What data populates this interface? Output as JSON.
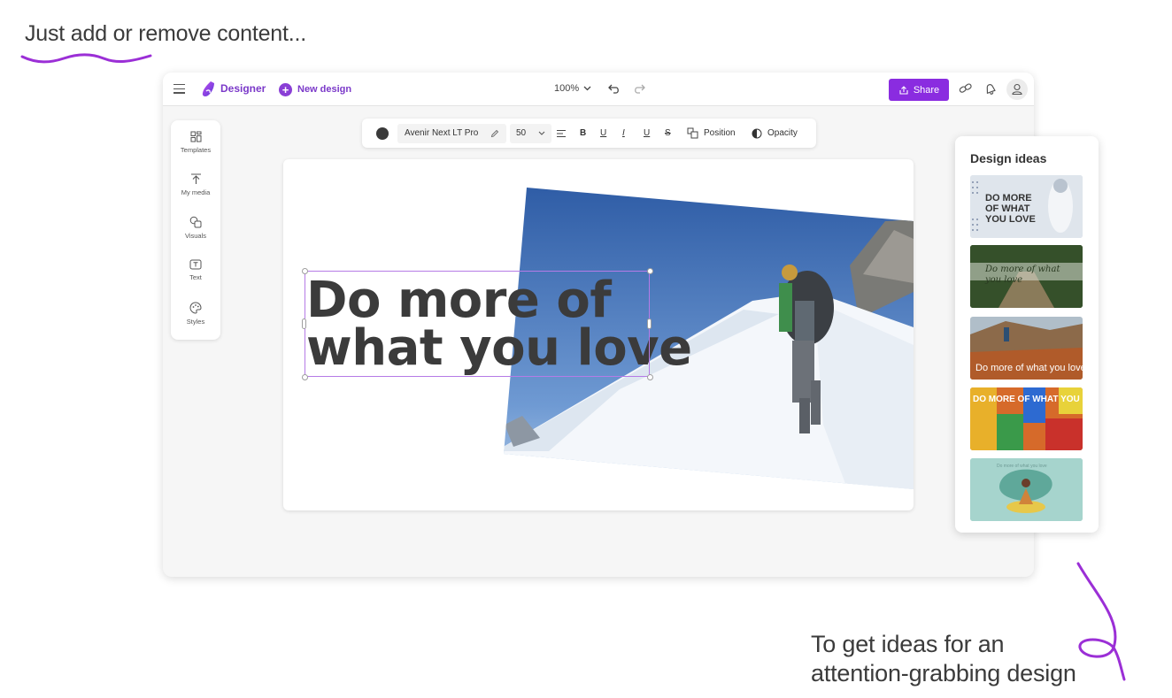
{
  "annotations": {
    "headline": "Just add or remove content...",
    "callout_line1": "To get ideas for an",
    "callout_line2": "attention-grabbing design",
    "ink_color": "#9b2fd6"
  },
  "topbar": {
    "brand": "Designer",
    "new_design": "New design",
    "zoom": "100%",
    "share": "Share",
    "accent": "#8a2ce0",
    "icons": [
      "menu-icon",
      "designer-logo-icon",
      "plus-circle-icon",
      "chevron-down-icon",
      "undo-icon",
      "redo-icon",
      "share-icon",
      "link-icon",
      "bell-icon",
      "person-icon"
    ]
  },
  "left_rail": {
    "items": [
      {
        "label": "Templates",
        "icon": "templates-icon"
      },
      {
        "label": "My media",
        "icon": "upload-icon"
      },
      {
        "label": "Visuals",
        "icon": "shapes-icon"
      },
      {
        "label": "Text",
        "icon": "text-box-icon"
      },
      {
        "label": "Styles",
        "icon": "palette-icon"
      }
    ]
  },
  "format_bar": {
    "font": "Avenir Next LT Pro",
    "size": "50",
    "bold": "B",
    "underline": "U",
    "italic": "I",
    "underline2": "U",
    "strike": "S",
    "position": "Position",
    "opacity": "Opacity",
    "text_color": "#3a3a3a"
  },
  "canvas": {
    "line1": "Do more of",
    "line2": "what you love",
    "selection_color": "#b57be6"
  },
  "design_ideas": {
    "title": "Design ideas",
    "thumbs": [
      {
        "text": "DO MORE OF WHAT YOU LOVE"
      },
      {
        "text": "Do more of what you love"
      },
      {
        "text": "Do more of what you love"
      },
      {
        "text": "DO MORE OF WHAT YOU LOVE"
      },
      {
        "text": "Do more of what you love"
      }
    ]
  }
}
